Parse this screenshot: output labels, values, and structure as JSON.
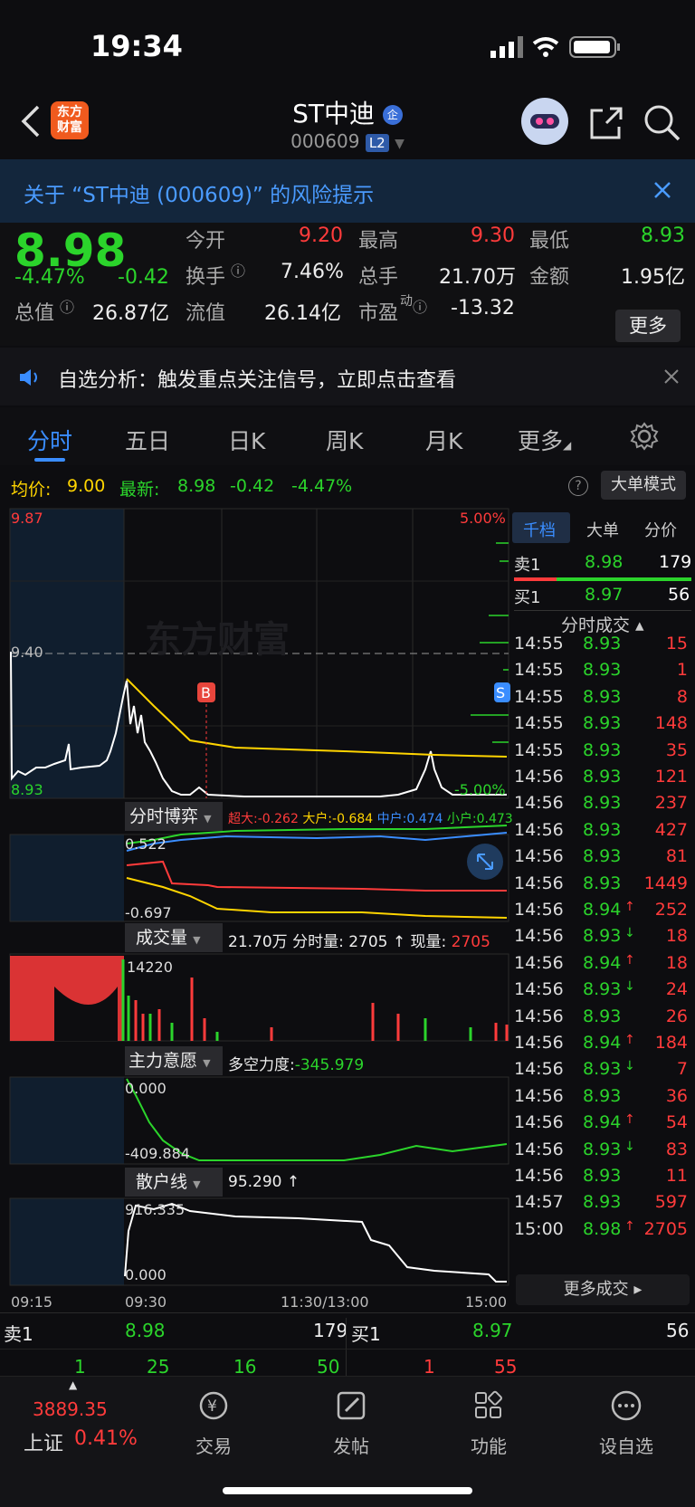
{
  "status": {
    "time": "19:34"
  },
  "header": {
    "title": "ST中迪",
    "code": "000609",
    "level": "L2",
    "badge": "企",
    "logo": "东方\n财富"
  },
  "risk": {
    "text": "关于 “ST中迪 (000609)” 的风险提示"
  },
  "quote": {
    "price": "8.98",
    "pct": "-4.47%",
    "change": "-0.42",
    "open_label": "今开",
    "open": "9.20",
    "high_label": "最高",
    "high": "9.30",
    "low_label": "最低",
    "low": "8.93",
    "turnover_label": "换手",
    "turnover": "7.46%",
    "vol_label": "总手",
    "vol": "21.70万",
    "amount_label": "金额",
    "amount": "1.95亿",
    "mcap_label": "总值",
    "mcap": "26.87亿",
    "float_label": "流值",
    "float": "26.14亿",
    "pe_label": "市盈",
    "pe_sup": "动",
    "pe": "-13.32",
    "more": "更多"
  },
  "notice": {
    "text": "自选分析：触发重点关注信号，立即点击查看"
  },
  "tabs": [
    "分时",
    "五日",
    "日K",
    "周K",
    "月K",
    "更多"
  ],
  "info": {
    "avg_label": "均价:",
    "avg": "9.00",
    "latest_label": "最新:",
    "latest": "8.98",
    "chg": "-0.42",
    "pct": "-4.47%",
    "mode": "大单模式"
  },
  "chart_labels": {
    "top": "9.87",
    "mid": "9.40",
    "bottom": "8.93",
    "up_pct": "5.00%",
    "down_pct": "-5.00%",
    "b_marker": "B",
    "s_marker": "S"
  },
  "bo": {
    "title": "分时博弈",
    "super": "超大:-0.262",
    "big": "大户:-0.684",
    "mid": "中户:0.474",
    "small": "小户:0.473",
    "max": "0.522",
    "min": "-0.697"
  },
  "volume": {
    "title": "成交量",
    "summary": "21.70万 分时量: 2705 ↑ 现量:",
    "now": "2705",
    "max": "14220"
  },
  "intent": {
    "title": "主力意愿",
    "force_label": "多空力度:",
    "force": "-345.979",
    "max": "0.000",
    "min": "-409.884"
  },
  "retail": {
    "title": "散户线",
    "value": "95.290 ↑",
    "max": "916.335",
    "min": "0.000"
  },
  "time_axis": [
    "09:15",
    "09:30",
    "11:30/13:00",
    "15:00"
  ],
  "side_tabs": [
    "千档",
    "大单",
    "分价"
  ],
  "orderbook": {
    "ask_label": "卖1",
    "ask_price": "8.98",
    "ask_vol": "179",
    "bid_label": "买1",
    "bid_price": "8.97",
    "bid_vol": "56"
  },
  "trades_title": "分时成交 ▴",
  "trades": [
    {
      "t": "14:55",
      "p": "8.93",
      "v": "15",
      "d": ""
    },
    {
      "t": "14:55",
      "p": "8.93",
      "v": "1",
      "d": ""
    },
    {
      "t": "14:55",
      "p": "8.93",
      "v": "8",
      "d": ""
    },
    {
      "t": "14:55",
      "p": "8.93",
      "v": "148",
      "d": ""
    },
    {
      "t": "14:55",
      "p": "8.93",
      "v": "35",
      "d": ""
    },
    {
      "t": "14:56",
      "p": "8.93",
      "v": "121",
      "d": ""
    },
    {
      "t": "14:56",
      "p": "8.93",
      "v": "237",
      "d": ""
    },
    {
      "t": "14:56",
      "p": "8.93",
      "v": "427",
      "d": ""
    },
    {
      "t": "14:56",
      "p": "8.93",
      "v": "81",
      "d": ""
    },
    {
      "t": "14:56",
      "p": "8.93",
      "v": "1449",
      "d": ""
    },
    {
      "t": "14:56",
      "p": "8.94",
      "v": "252",
      "d": "↑"
    },
    {
      "t": "14:56",
      "p": "8.93",
      "v": "18",
      "d": "↓"
    },
    {
      "t": "14:56",
      "p": "8.94",
      "v": "18",
      "d": "↑"
    },
    {
      "t": "14:56",
      "p": "8.93",
      "v": "24",
      "d": "↓"
    },
    {
      "t": "14:56",
      "p": "8.93",
      "v": "26",
      "d": ""
    },
    {
      "t": "14:56",
      "p": "8.94",
      "v": "184",
      "d": "↑"
    },
    {
      "t": "14:56",
      "p": "8.93",
      "v": "7",
      "d": "↓"
    },
    {
      "t": "14:56",
      "p": "8.93",
      "v": "36",
      "d": ""
    },
    {
      "t": "14:56",
      "p": "8.94",
      "v": "54",
      "d": "↑"
    },
    {
      "t": "14:56",
      "p": "8.93",
      "v": "83",
      "d": "↓"
    },
    {
      "t": "14:56",
      "p": "8.93",
      "v": "11",
      "d": ""
    },
    {
      "t": "14:57",
      "p": "8.93",
      "v": "597",
      "d": ""
    },
    {
      "t": "15:00",
      "p": "8.98",
      "v": "2705",
      "d": "↑"
    }
  ],
  "more_trades": "更多成交 ▸",
  "bottom": {
    "ask_label": "卖1",
    "ask_price": "8.98",
    "ask_vol": "179",
    "bid_label": "买1",
    "bid_price": "8.97",
    "bid_vol": "56",
    "ask_nums": [
      "1",
      "25",
      "16",
      "50"
    ],
    "bid_nums": [
      "1",
      "55"
    ]
  },
  "nav": {
    "index_value": "3889.35",
    "index_name": "上证",
    "index_pct": "0.41%",
    "items": [
      "交易",
      "发帖",
      "功能",
      "设自选"
    ]
  },
  "colors": {
    "red": "#ff3b3b",
    "green": "#2bd42b",
    "yellow": "#ffd400",
    "blue": "#3a8dff"
  }
}
